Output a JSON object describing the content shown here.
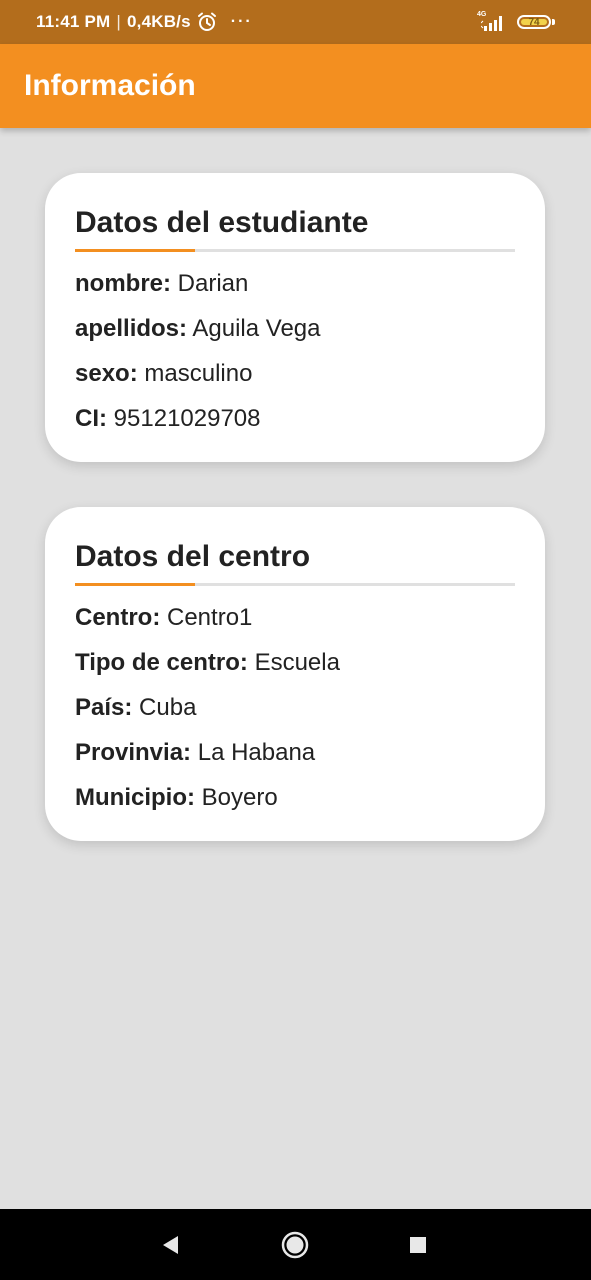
{
  "status_bar": {
    "time": "11:41 PM",
    "separator": "|",
    "network_speed": "0,4KB/s",
    "more": "···",
    "network_type": "4G",
    "battery_level": "74",
    "battery_color": "#f2d24a",
    "background_color": "#b36d1c"
  },
  "app_bar": {
    "title": "Información",
    "background_color": "#f38f20"
  },
  "student_card": {
    "title": "Datos del estudiante",
    "fields": [
      {
        "label": "nombre:",
        "value": "Darian"
      },
      {
        "label": "apellidos:",
        "value": "Aguila Vega"
      },
      {
        "label": "sexo:",
        "value": "masculino"
      },
      {
        "label": "CI:",
        "value": "95121029708"
      }
    ]
  },
  "center_card": {
    "title": "Datos del centro",
    "fields": [
      {
        "label": "Centro:",
        "value": "Centro1"
      },
      {
        "label": "Tipo de centro:",
        "value": "Escuela"
      },
      {
        "label": "País:",
        "value": "Cuba"
      },
      {
        "label": "Provinvia:",
        "value": "La Habana"
      },
      {
        "label": "Municipio:",
        "value": "Boyero"
      }
    ]
  },
  "nav_bar": {
    "buttons": [
      "back-icon",
      "home-icon",
      "recent-apps-icon"
    ]
  },
  "colors": {
    "accent": "#f38f20",
    "page_background": "#e0e0e0",
    "card_background": "#ffffff",
    "text": "#222222"
  }
}
